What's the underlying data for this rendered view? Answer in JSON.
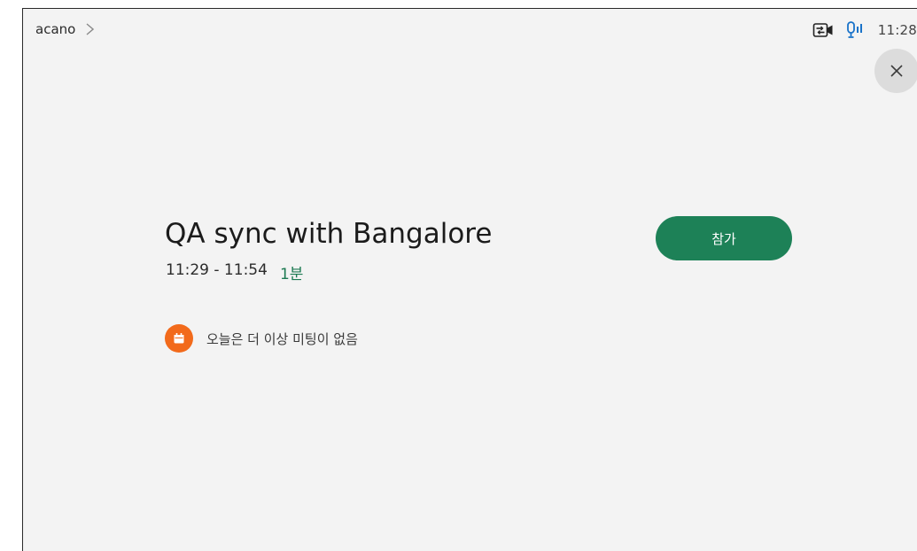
{
  "header": {
    "breadcrumb": "acano",
    "clock": "11:28"
  },
  "meeting": {
    "title": "QA sync with Bangalore",
    "time_range": "11:29 - 11:54",
    "countdown": "1분",
    "join_label": "참가"
  },
  "notice": {
    "text": "오늘은 더 이상 미팅이 없음"
  },
  "icons": {
    "camera": "camera-share-icon",
    "mic": "microphone-levels-icon",
    "close": "close-icon",
    "calendar": "calendar-icon",
    "chevron": "chevron-right-icon"
  },
  "colors": {
    "join_button": "#1d8157",
    "countdown": "#1d7a52",
    "calendar_badge": "#f26a1b",
    "mic_icon": "#1a73c9"
  }
}
